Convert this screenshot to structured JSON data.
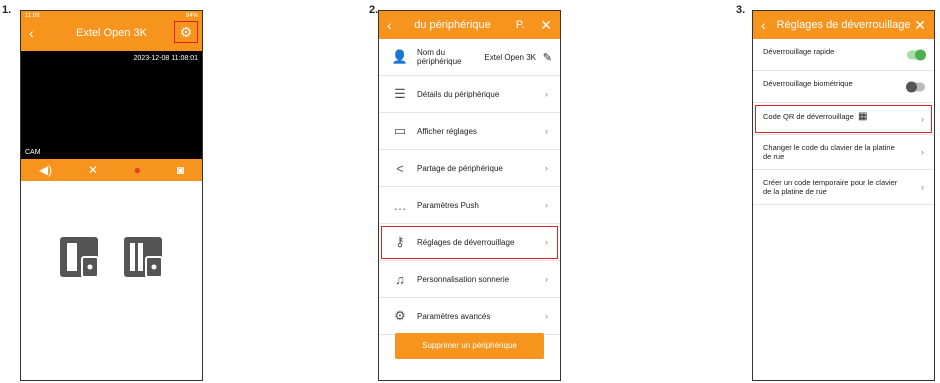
{
  "steps": [
    "1.",
    "2.",
    "3."
  ],
  "screen1": {
    "status_time": "11:08",
    "status_right": "84%",
    "title": "Extel Open 3K",
    "timestamp": "2023-12-08 11:08:01",
    "cam_label": "CAM",
    "controls": [
      {
        "icon": "speaker-icon",
        "glyph": "◀)"
      },
      {
        "icon": "mic-muted-icon",
        "glyph": "✕"
      },
      {
        "icon": "record-icon",
        "glyph": "●"
      },
      {
        "icon": "camera-icon",
        "glyph": "◙"
      }
    ],
    "locks": [
      "unlock-door-1-icon",
      "unlock-door-2-icon"
    ]
  },
  "screen2": {
    "title": "du périphérique",
    "title_right": "P.",
    "device_name_label": "Nom du périphérique",
    "device_name_value": "Extel Open 3K",
    "items": [
      {
        "icon": "list-icon",
        "glyph": "☰",
        "label": "Détails du périphérique"
      },
      {
        "icon": "laptop-icon",
        "glyph": "▭",
        "label": "Afficher réglages"
      },
      {
        "icon": "share-icon",
        "glyph": "<",
        "label": "Partage de périphérique"
      },
      {
        "icon": "chat-icon",
        "glyph": "…",
        "label": "Paramètres Push"
      },
      {
        "icon": "key-icon",
        "glyph": "⚷",
        "label": "Réglages de déverrouillage"
      },
      {
        "icon": "music-icon",
        "glyph": "♫",
        "label": "Personnalisation sonnerie"
      },
      {
        "icon": "gear-icon",
        "glyph": "⚙",
        "label": "Paramètres avancés"
      }
    ],
    "delete_label": "Supprimer un périphérique"
  },
  "screen3": {
    "title": "Réglages de déverrouillage",
    "items": [
      {
        "label": "Déverrouillage rapide",
        "type": "toggle",
        "state": "on"
      },
      {
        "label": "Déverrouillage biométrique",
        "type": "toggle",
        "state": "off"
      },
      {
        "label": "Code QR de déverrouillage",
        "type": "link"
      },
      {
        "label": "Changer le code du clavier de la platine de rue",
        "type": "link"
      },
      {
        "label": "Créer un code temporaire pour le clavier de la platine de rue",
        "type": "link"
      }
    ]
  },
  "colors": {
    "accent": "#f7941d",
    "highlight": "#d22222",
    "toggle_on": "#4caf50"
  }
}
